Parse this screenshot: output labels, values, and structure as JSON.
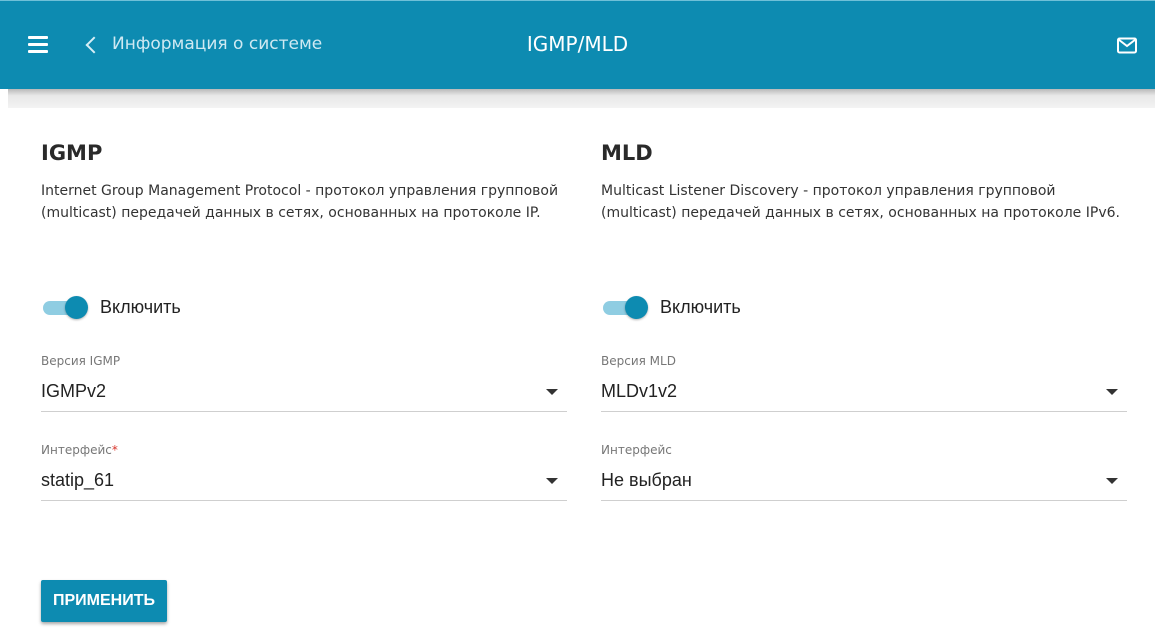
{
  "header": {
    "back_label": "Информация о системе",
    "title": "IGMP/MLD",
    "color": "#0d8bb1"
  },
  "igmp": {
    "heading": "IGMP",
    "description": "Internet Group Management Protocol - протокол управления групповой (multicast) передачей данных в сетях, основанных на протоколе IP.",
    "enable_label": "Включить",
    "enabled": true,
    "version_label": "Версия IGMP",
    "version_value": "IGMPv2",
    "interface_label": "Интерфейс",
    "interface_required": "*",
    "interface_value": "statip_61"
  },
  "mld": {
    "heading": "MLD",
    "description": "Multicast Listener Discovery - протокол управления групповой (multicast) передачей данных в сетях, основанных на протоколе IPv6.",
    "enable_label": "Включить",
    "enabled": true,
    "version_label": "Версия MLD",
    "version_value": "MLDv1v2",
    "interface_label": "Интерфейс",
    "interface_value": "Не выбран"
  },
  "actions": {
    "apply_label": "ПРИМЕНИТЬ"
  },
  "icons": {
    "menu": "hamburger-menu-icon",
    "back": "chevron-left-icon",
    "mail": "mail-icon",
    "dropdown": "caret-down-icon"
  }
}
